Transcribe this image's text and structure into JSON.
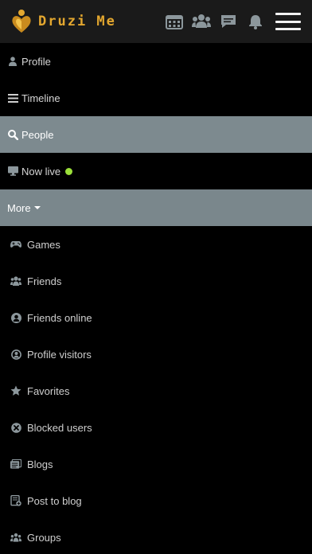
{
  "header": {
    "brand": "Druzi Me",
    "icons": [
      "calendar-icon",
      "group-icon",
      "chat-icon",
      "bell-icon",
      "menu-icon"
    ]
  },
  "menu": {
    "primary": [
      {
        "label": "Profile",
        "icon": "user-icon"
      },
      {
        "label": "Timeline",
        "icon": "list-icon"
      },
      {
        "label": "People",
        "icon": "search-icon",
        "active": true
      },
      {
        "label": "Now live",
        "icon": "monitor-icon",
        "status": "online"
      }
    ],
    "more_label": "More",
    "sub": [
      {
        "label": "Games",
        "icon": "gamepad-icon"
      },
      {
        "label": "Friends",
        "icon": "friends-icon"
      },
      {
        "label": "Friends online",
        "icon": "user-circle-icon"
      },
      {
        "label": "Profile visitors",
        "icon": "user-circle-outline-icon"
      },
      {
        "label": "Favorites",
        "icon": "star-icon"
      },
      {
        "label": "Blocked users",
        "icon": "block-icon"
      },
      {
        "label": "Blogs",
        "icon": "blogs-icon"
      },
      {
        "label": "Post to blog",
        "icon": "post-blog-icon"
      },
      {
        "label": "Groups",
        "icon": "groups-icon"
      }
    ]
  },
  "colors": {
    "header_bg": "#1a1a1a",
    "active_bg": "#7d8a8f",
    "brand": "#e3a72f",
    "live_dot": "#9be03a",
    "icon_gray": "#8c979c"
  }
}
